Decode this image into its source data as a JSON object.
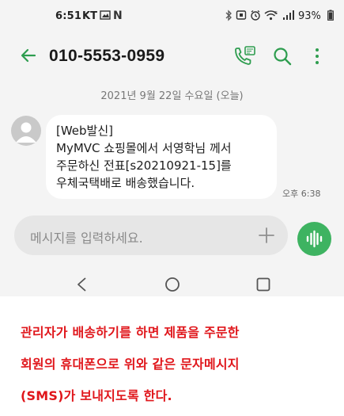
{
  "status_bar": {
    "time": "6:51",
    "carrier": "KT",
    "battery": "93%"
  },
  "app_bar": {
    "title": "010-5553-0959",
    "icons": [
      "back-arrow-icon",
      "call-icon",
      "search-icon",
      "more-icon"
    ]
  },
  "conversation": {
    "date_divider": "2021년 9월 22일 수요일 (오늘)",
    "message": {
      "lines": [
        "[Web발신]",
        "MyMVC 쇼핑몰에서 서영학님 께서",
        "주문하신 전표[s20210921-15]를",
        "우체국택배로 배송했습니다."
      ],
      "time": "오후 6:38"
    }
  },
  "composer": {
    "placeholder": "메시지를 입력하세요."
  },
  "caption": {
    "lines": [
      "관리자가 배송하기를 하면 제품을 주문한",
      "회원의 휴대폰으로 위와 같은 문자메시지",
      "(SMS)가 보내지도록 한다."
    ]
  },
  "colors": {
    "accent_green": "#2e9d4f",
    "voice_button": "#3eb361",
    "caption_red": "#e0161b"
  }
}
